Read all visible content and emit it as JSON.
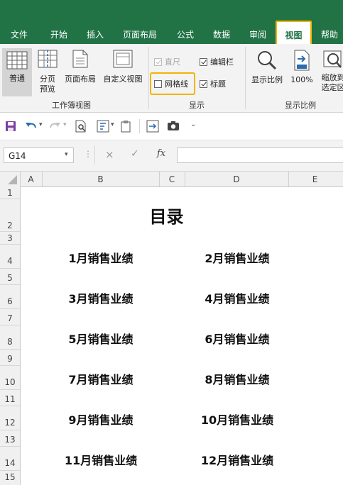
{
  "ribbon_tabs": [
    "文件",
    "开始",
    "插入",
    "页面布局",
    "公式",
    "数据",
    "审阅",
    "视图",
    "帮助"
  ],
  "active_tab": "视图",
  "groups": {
    "workbook_views": {
      "label": "工作簿视图",
      "normal": "普通",
      "page_break_l1": "分页",
      "page_break_l2": "预览",
      "page_layout": "页面布局",
      "custom_views": "自定义视图"
    },
    "show": {
      "label": "显示",
      "ruler": "直尺",
      "formula_bar": "编辑栏",
      "gridlines": "网格线",
      "headings": "标题",
      "ruler_checked": true,
      "formula_bar_checked": true,
      "gridlines_checked": false,
      "headings_checked": true
    },
    "zoom": {
      "label": "显示比例",
      "zoom": "显示比例",
      "hundred": "100%",
      "selection_l1": "缩放到",
      "selection_l2": "选定区"
    }
  },
  "formula_bar": {
    "name_box": "G14",
    "cancel_icon": "×",
    "enter_icon": "✓",
    "fx": "fx",
    "value": ""
  },
  "columns": [
    "A",
    "B",
    "C",
    "D",
    "E"
  ],
  "rows": [
    "1",
    "2",
    "3",
    "4",
    "5",
    "6",
    "7",
    "8",
    "9",
    "10",
    "11",
    "12",
    "13",
    "14",
    "15"
  ],
  "sheet": {
    "title": "目录",
    "links": [
      [
        "1月销售业绩",
        "2月销售业绩"
      ],
      [
        "3月销售业绩",
        "4月销售业绩"
      ],
      [
        "5月销售业绩",
        "6月销售业绩"
      ],
      [
        "7月销售业绩",
        "8月销售业绩"
      ],
      [
        "9月销售业绩",
        "10月销售业绩"
      ],
      [
        "11月销售业绩",
        "12月销售业绩"
      ]
    ]
  }
}
